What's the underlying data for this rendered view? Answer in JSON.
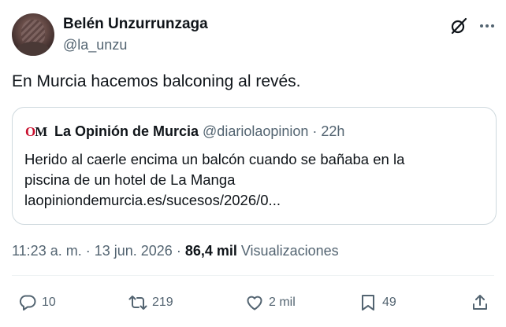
{
  "author": {
    "name": "Belén Unzurrunzaga",
    "handle": "@la_unzu"
  },
  "tweet": {
    "text": "En Murcia hacemos balconing al revés."
  },
  "quoted": {
    "logo_text_a": "O",
    "logo_text_b": "M",
    "name": "La Opinión de Murcia",
    "handle": "@diariolaopinion",
    "separator": " · ",
    "age": "22h",
    "body_line1": "Herido al caerle encima un balcón cuando se bañaba en la",
    "body_line2": "piscina de un hotel de La Manga",
    "body_line3": "laopiniondemurcia.es/sucesos/2026/0..."
  },
  "meta": {
    "time": "11:23 a. m.",
    "separator": " · ",
    "date": "13 jun. 2026",
    "views_count": "86,4 mil",
    "views_label": "Visualizaciones"
  },
  "actions": {
    "replies": "10",
    "retweets": "219",
    "likes": "2 mil",
    "bookmarks": "49"
  },
  "icons": {
    "grok": "grok-icon",
    "more": "more-icon",
    "reply": "reply-icon",
    "retweet": "retweet-icon",
    "like": "heart-icon",
    "bookmark": "bookmark-icon",
    "share": "share-icon"
  },
  "colors": {
    "text": "#0f1419",
    "secondary": "#536471",
    "border": "#cfd9de",
    "logo_accent": "#c8102e"
  }
}
